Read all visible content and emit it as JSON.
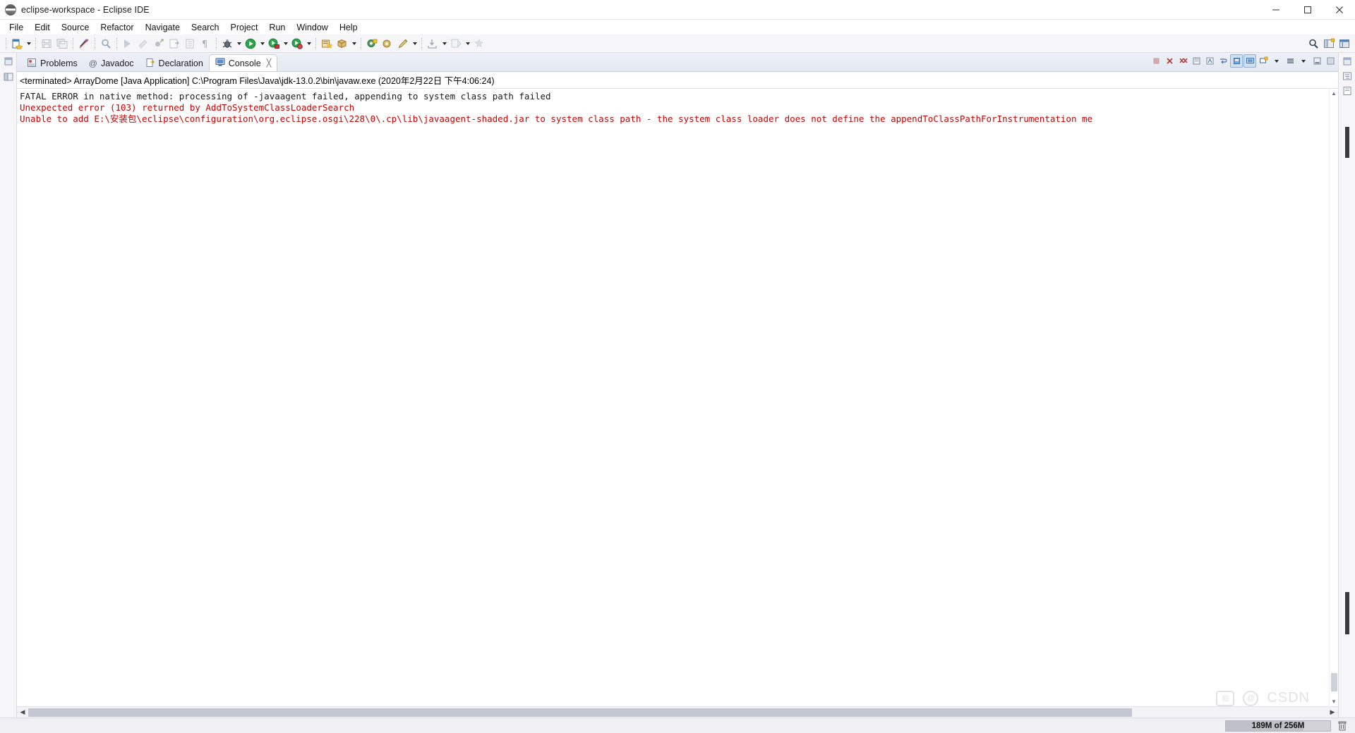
{
  "window": {
    "title": "eclipse-workspace - Eclipse IDE",
    "app_icon": "eclipse-icon",
    "minimize_label": "—",
    "maximize_label": "☐",
    "close_label": "✕"
  },
  "menubar": {
    "items": [
      {
        "label": "File",
        "mnemonic": "F"
      },
      {
        "label": "Edit",
        "mnemonic": "E"
      },
      {
        "label": "Source",
        "mnemonic": "S"
      },
      {
        "label": "Refactor",
        "mnemonic": "t"
      },
      {
        "label": "Navigate",
        "mnemonic": "N"
      },
      {
        "label": "Search",
        "mnemonic": "a"
      },
      {
        "label": "Project",
        "mnemonic": "P"
      },
      {
        "label": "Run",
        "mnemonic": "R"
      },
      {
        "label": "Window",
        "mnemonic": "W"
      },
      {
        "label": "Help",
        "mnemonic": "H"
      }
    ]
  },
  "toolbar": {
    "buttons": [
      {
        "name": "new-wizard-icon",
        "tooltip": "New"
      },
      {
        "name": "new-dropdown-arrow",
        "tooltip": "New menu"
      },
      {
        "name": "save-icon",
        "tooltip": "Save"
      },
      {
        "name": "save-all-icon",
        "tooltip": "Save All"
      },
      {
        "name": "link-icon",
        "tooltip": "Toggle Link"
      },
      {
        "name": "search-icon",
        "tooltip": "Search"
      },
      {
        "name": "next-annotation-icon",
        "tooltip": "Next Annotation"
      },
      {
        "name": "previous-annotation-icon",
        "tooltip": "Previous Annotation"
      },
      {
        "name": "last-edit-icon",
        "tooltip": "Last Edit Location"
      },
      {
        "name": "back-icon",
        "tooltip": "Back"
      },
      {
        "name": "pilcrow-icon",
        "tooltip": "Show Whitespace"
      },
      {
        "name": "debug-icon",
        "tooltip": "Debug"
      },
      {
        "name": "debug-dropdown-arrow",
        "tooltip": "Debug menu"
      },
      {
        "name": "run-icon",
        "tooltip": "Run"
      },
      {
        "name": "run-dropdown-arrow",
        "tooltip": "Run menu"
      },
      {
        "name": "coverage-icon",
        "tooltip": "Coverage"
      },
      {
        "name": "coverage-dropdown-arrow",
        "tooltip": "Coverage menu"
      },
      {
        "name": "profile-icon",
        "tooltip": "Profile"
      },
      {
        "name": "profile-dropdown-arrow",
        "tooltip": "Profile menu"
      },
      {
        "name": "new-java-project-icon",
        "tooltip": "New Java Project"
      },
      {
        "name": "new-package-icon",
        "tooltip": "New Package"
      },
      {
        "name": "new-package-arrow",
        "tooltip": "New Package menu"
      },
      {
        "name": "new-class-icon",
        "tooltip": "New Class"
      },
      {
        "name": "new-interface-icon",
        "tooltip": "New Interface"
      },
      {
        "name": "edit-icon",
        "tooltip": "Edit"
      },
      {
        "name": "edit-dropdown-arrow",
        "tooltip": "Edit menu"
      },
      {
        "name": "import-icon",
        "tooltip": "Import"
      },
      {
        "name": "import-arrow",
        "tooltip": "Import menu"
      },
      {
        "name": "export-icon",
        "tooltip": "Export"
      },
      {
        "name": "export-arrow",
        "tooltip": "Export menu"
      },
      {
        "name": "extra-icon",
        "tooltip": "More"
      }
    ],
    "right_buttons": [
      {
        "name": "quick-access-search-icon",
        "tooltip": "Quick Access"
      },
      {
        "name": "open-perspective-icon",
        "tooltip": "Open Perspective"
      },
      {
        "name": "java-perspective-icon",
        "tooltip": "Java"
      }
    ]
  },
  "tabs": [
    {
      "label": "Problems",
      "icon": "problems-icon",
      "active": false,
      "closable": false
    },
    {
      "label": "Javadoc",
      "icon": "javadoc-icon",
      "active": false,
      "closable": false
    },
    {
      "label": "Declaration",
      "icon": "declaration-icon",
      "active": false,
      "closable": false
    },
    {
      "label": "Console",
      "icon": "console-icon",
      "active": true,
      "closable": true
    }
  ],
  "tab_close_glyph": "╳",
  "view_toolbar": {
    "buttons": [
      {
        "name": "terminate-icon",
        "tooltip": "Terminate",
        "toggled": false,
        "disabled": true
      },
      {
        "name": "remove-launch-icon",
        "tooltip": "Remove Launch",
        "toggled": false,
        "disabled": false
      },
      {
        "name": "remove-all-launches-icon",
        "tooltip": "Remove All Terminated Launches",
        "toggled": false,
        "disabled": false
      },
      {
        "name": "clear-console-icon",
        "tooltip": "Clear Console",
        "toggled": false,
        "disabled": false
      },
      {
        "name": "scroll-lock-icon",
        "tooltip": "Scroll Lock",
        "toggled": false,
        "disabled": false
      },
      {
        "name": "word-wrap-icon",
        "tooltip": "Word Wrap",
        "toggled": false,
        "disabled": false
      },
      {
        "name": "pin-console-icon",
        "tooltip": "Pin Console",
        "toggled": true,
        "disabled": false
      },
      {
        "name": "display-console-icon",
        "tooltip": "Display Selected Console",
        "toggled": true,
        "disabled": false
      },
      {
        "name": "new-console-icon",
        "tooltip": "Open Console",
        "toggled": false,
        "disabled": false
      },
      {
        "name": "new-console-arrow",
        "tooltip": "Open Console menu",
        "toggled": false,
        "disabled": false
      },
      {
        "name": "view-menu-icon",
        "tooltip": "View Menu",
        "toggled": false,
        "disabled": false
      },
      {
        "name": "view-menu-arrow",
        "tooltip": "View Menu arrow",
        "toggled": false,
        "disabled": false
      },
      {
        "name": "minimize-view-icon",
        "tooltip": "Minimize",
        "toggled": false,
        "disabled": false
      },
      {
        "name": "maximize-view-icon",
        "tooltip": "Maximize",
        "toggled": false,
        "disabled": false
      }
    ]
  },
  "console": {
    "header": "<terminated> ArrayDome [Java Application] C:\\Program Files\\Java\\jdk-13.0.2\\bin\\javaw.exe (2020年2月22日 下午4:06:24)",
    "lines": [
      {
        "stream": "out",
        "text": "FATAL ERROR in native method: processing of -javaagent failed, appending to system class path failed"
      },
      {
        "stream": "err",
        "text": "Unexpected error (103) returned by AddToSystemClassLoaderSearch"
      },
      {
        "stream": "err",
        "text": "Unable to add E:\\安装包\\eclipse\\configuration\\org.eclipse.osgi\\228\\0\\.cp\\lib\\javaagent-shaded.jar to system class path - the system class loader does not define the appendToClassPathForInstrumentation me"
      }
    ],
    "scroll_up_glyph": "▲",
    "scroll_down_glyph": "▼",
    "scroll_left_glyph": "◀",
    "scroll_right_glyph": "▶"
  },
  "statusbar": {
    "memory_label": "189M of 256M",
    "memory_used_percent": 74,
    "trash_icon": "trash-icon"
  },
  "watermark": {
    "badge": "知",
    "text": "CSDN",
    "circle": "@"
  },
  "colors": {
    "error_text": "#cc0000",
    "output_text": "#1a1a1a",
    "tab_active_bg": "#ffffff",
    "toolbar_bg": "#f6f6f8",
    "tabbar_bg": "#e3e8f2",
    "accent": "#2f6fb5"
  }
}
